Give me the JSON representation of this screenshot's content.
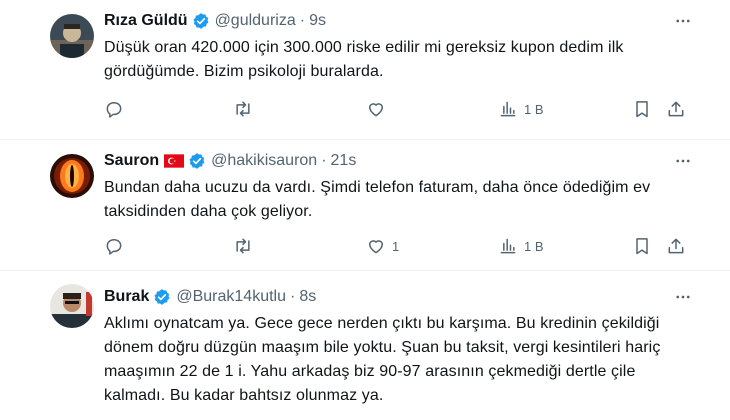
{
  "tweets": [
    {
      "name": "Rıza Güldü",
      "handle": "@gulduriza",
      "separator": "·",
      "time": "9s",
      "text": "Düşük oran 420.000 için 300.000 riske edilir mi gereksiz kupon dedim ilk gördüğümde. Bizim psikoloji buralarda.",
      "reply_count": "",
      "retweet_count": "",
      "like_count": "",
      "view_count": "1 B",
      "avatar_colors": [
        "#3b4a55",
        "#c9b79a"
      ]
    },
    {
      "name": "Sauron",
      "handle": "@hakikisauron",
      "separator": "·",
      "time": "21s",
      "text": "Bundan daha ucuzu da vardı. Şimdi telefon faturam, daha önce ödediğim ev taksidinden daha çok geliyor.",
      "reply_count": "",
      "retweet_count": "",
      "like_count": "1",
      "view_count": "1 B",
      "avatar_colors": [
        "#2a0d05",
        "#ff7a1a"
      ]
    },
    {
      "name": "Burak",
      "handle": "@Burak14kutlu",
      "separator": "·",
      "time": "8s",
      "text": "Aklımı oynatcam ya. Gece gece nerden çıktı bu karşıma. Bu kredinin çekildiği dönem doğru düzgün maaşım bile yoktu. Şuan bu taksit, vergi kesintileri hariç maaşımın 22 de 1 i. Yahu arkadaş biz 90-97 arasının çekmediği dertle çile kalmadı. Bu kadar bahtsız olunmaz ya.",
      "reply_count": "",
      "retweet_count": "",
      "like_count": "",
      "view_count": "",
      "avatar_colors": [
        "#e8e6e0",
        "#24303a"
      ]
    }
  ],
  "colors": {
    "verified": "#1d9bf0",
    "text_primary": "#0f1419",
    "text_secondary": "#536471",
    "divider": "#eff3f4",
    "flag_red": "#e30a17"
  },
  "icons": [
    "verified-badge-icon",
    "turkey-flag-icon",
    "more-icon",
    "reply-icon",
    "retweet-icon",
    "like-icon",
    "views-icon",
    "bookmark-icon",
    "share-icon"
  ]
}
